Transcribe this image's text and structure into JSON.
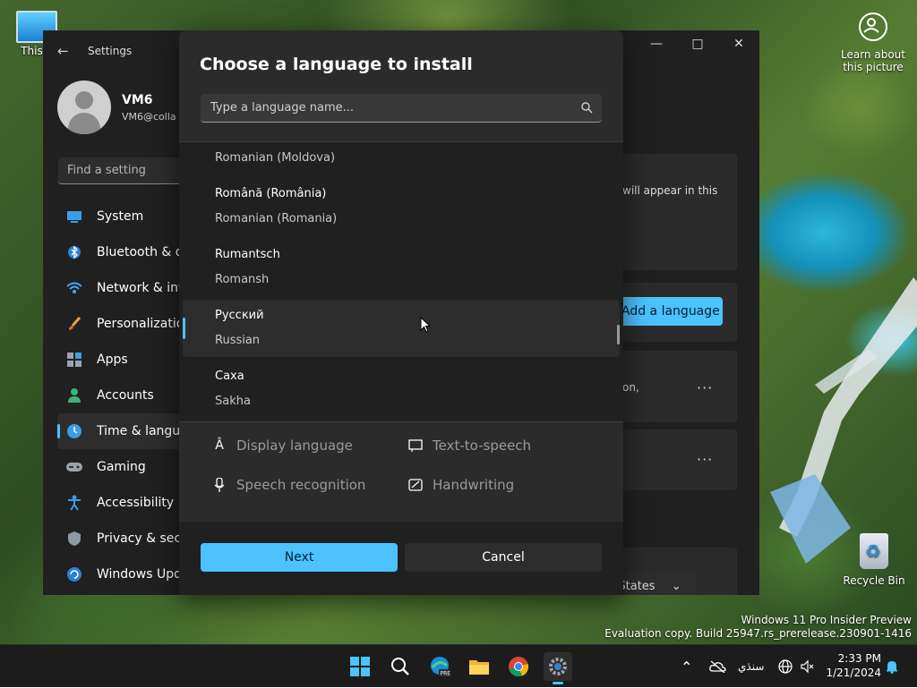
{
  "desktop": {
    "this_pc_label": "This P",
    "learn_label_1": "Learn about",
    "learn_label_2": "this picture",
    "recycle_label": "Recycle Bin",
    "watermark_line1": "Windows 11 Pro Insider Preview",
    "watermark_line2": "Evaluation copy. Build 25947.rs_prerelease.230901-1416"
  },
  "settings": {
    "title": "Settings",
    "user_name": "VM6",
    "user_email": "VM6@colla",
    "find_placeholder": "Find a setting",
    "nav": [
      {
        "label": "System",
        "icon": "system-icon"
      },
      {
        "label": "Bluetooth & de",
        "icon": "bluetooth-icon"
      },
      {
        "label": "Network & inte",
        "icon": "wifi-icon"
      },
      {
        "label": "Personalization",
        "icon": "brush-icon"
      },
      {
        "label": "Apps",
        "icon": "apps-icon"
      },
      {
        "label": "Accounts",
        "icon": "accounts-icon"
      },
      {
        "label": "Time & langua",
        "icon": "time-language-icon",
        "active": true
      },
      {
        "label": "Gaming",
        "icon": "gamepad-icon"
      },
      {
        "label": "Accessibility",
        "icon": "accessibility-icon"
      },
      {
        "label": "Privacy & secu",
        "icon": "shield-icon"
      },
      {
        "label": "Windows Upda",
        "icon": "update-icon"
      }
    ],
    "right_text_1": "will appear in this",
    "add_language_label": "Add a language",
    "right_text_2": "on,",
    "region_value": "d States"
  },
  "dialog": {
    "title": "Choose a language to install",
    "search_placeholder": "Type a language name...",
    "languages": [
      {
        "native": "",
        "english": "Romanian (Moldova)"
      },
      {
        "native": "Română (România)",
        "english": "Romanian (Romania)"
      },
      {
        "native": "Rumantsch",
        "english": "Romansh"
      },
      {
        "native": "Русский",
        "english": "Russian",
        "hover": true
      },
      {
        "native": "Саха",
        "english": "Sakha"
      }
    ],
    "features": {
      "display_language": "Display language",
      "text_to_speech": "Text-to-speech",
      "speech_recognition": "Speech recognition",
      "handwriting": "Handwriting"
    },
    "next_label": "Next",
    "cancel_label": "Cancel"
  },
  "taskbar": {
    "input_indicator": "سنڌي",
    "time": "2:33 PM",
    "date": "1/21/2024"
  },
  "colors": {
    "accent": "#4cc2ff",
    "dialog_bg": "#2b2b2b",
    "window_bg": "#202020",
    "taskbar_bg": "#1c1c1c"
  }
}
